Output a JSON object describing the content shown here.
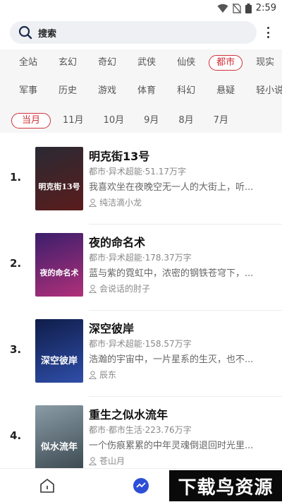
{
  "status_bar": {
    "time": "2:59"
  },
  "search": {
    "label": "搜索"
  },
  "categories_row1": [
    "全站",
    "玄幻",
    "奇幻",
    "武侠",
    "仙侠",
    "都市",
    "现实"
  ],
  "categories_row2": [
    "军事",
    "历史",
    "游戏",
    "体育",
    "科幻",
    "悬疑",
    "轻小说"
  ],
  "active_category": "都市",
  "months": [
    "当月",
    "11月",
    "10月",
    "9月",
    "8月",
    "7月"
  ],
  "active_month": "当月",
  "books": [
    {
      "rank": "1.",
      "title": "明克街13号",
      "meta": "都市·异术超能·51.17万字",
      "desc": "我喜欢坐在夜晚空无一人的大街上，听...",
      "author": "纯洁滴小龙",
      "cover_text": "明克街13号",
      "cover_colors": [
        "#2a2a33",
        "#5a1c1c"
      ]
    },
    {
      "rank": "2.",
      "title": "夜的命名术",
      "meta": "都市·异术超能·178.37万字",
      "desc": "蓝与紫的霓虹中，浓密的钢铁苍穹下，...",
      "author": "会说话的肘子",
      "cover_text": "夜的命名术",
      "cover_colors": [
        "#3b1e6b",
        "#b0307a"
      ]
    },
    {
      "rank": "3.",
      "title": "深空彼岸",
      "meta": "都市·异术超能·158.57万字",
      "desc": "浩瀚的宇宙中，一片星系的生灭，也不...",
      "author": "辰东",
      "cover_text": "深空彼岸",
      "cover_colors": [
        "#0f1d4a",
        "#2f4ea8"
      ]
    },
    {
      "rank": "4.",
      "title": "重生之似水流年",
      "meta": "都市·都市生活·223.76万字",
      "desc": "一个伤痕累累的中年灵魂倒退回时光里...",
      "author": "苍山月",
      "cover_text": "似水流年",
      "cover_colors": [
        "#8a9ca6",
        "#3d4a52"
      ]
    }
  ],
  "watermark": "下载鸟资源",
  "colors": {
    "accent": "#d0303a",
    "filter_bg": "#f6f6f6",
    "search_bg": "#eef0f3",
    "tab_active": "#2d4fd6"
  }
}
